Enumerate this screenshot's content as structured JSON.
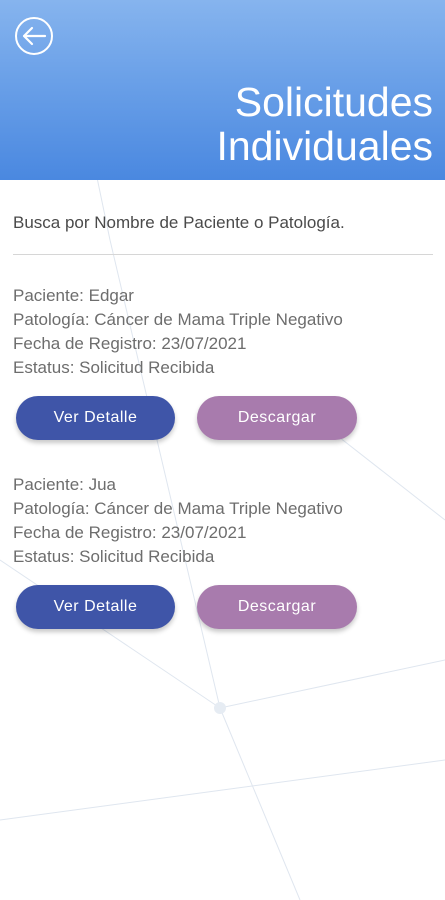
{
  "header": {
    "title_line1": "Solicitudes",
    "title_line2": "Individuales",
    "back_icon": "arrow-left-icon",
    "gradient_colors": [
      "#86b4ee",
      "#4a88e0"
    ]
  },
  "search": {
    "text": "Busca por Nombre de Paciente o Patología."
  },
  "requests": [
    {
      "paciente": "Paciente: Edgar",
      "patologia": "Patología: Cáncer de Mama Triple Negativo",
      "fecha": "Fecha de Registro: 23/07/2021",
      "estatus": "Estatus: Solicitud Recibida",
      "detail_label": "Ver Detalle",
      "download_label": "Descargar"
    },
    {
      "paciente": "Paciente: Jua",
      "patologia": "Patología: Cáncer de Mama Triple Negativo",
      "fecha": "Fecha de Registro: 23/07/2021",
      "estatus": "Estatus: Solicitud Recibida",
      "detail_label": "Ver Detalle",
      "download_label": "Descargar"
    }
  ],
  "colors": {
    "detail_button": "#3f55a8",
    "download_button": "#a87bad",
    "text": "#6d6d6d"
  }
}
